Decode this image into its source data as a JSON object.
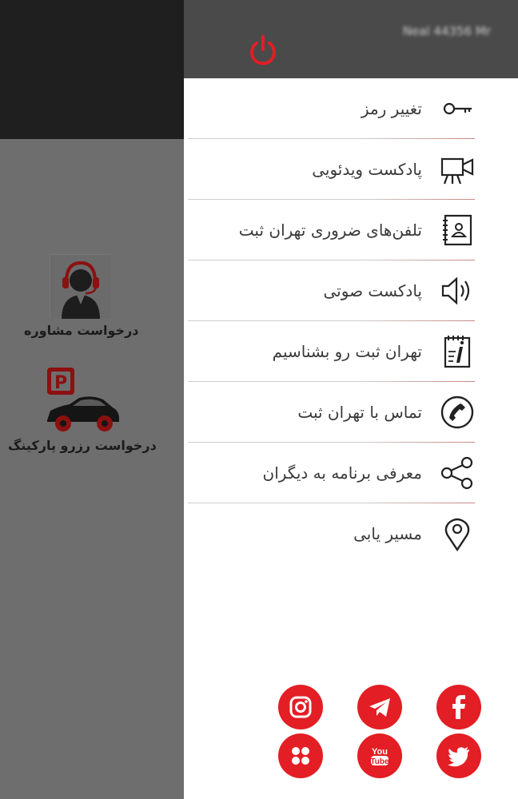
{
  "header": {
    "user_text": "Neal 44356 Mr",
    "power_icon": "power-icon"
  },
  "menu": [
    {
      "label": "تغییر رمز",
      "icon": "key-icon"
    },
    {
      "label": "پادکست ویدئویی",
      "icon": "video-camera-icon"
    },
    {
      "label": "تلفن‌های ضروری تهران ثبت",
      "icon": "address-book-icon"
    },
    {
      "label": "پادکست صوتی",
      "icon": "speaker-icon"
    },
    {
      "label": "تهران ثبت رو بشناسیم",
      "icon": "info-notepad-icon"
    },
    {
      "label": "تماس با تهران ثبت",
      "icon": "phone-icon"
    },
    {
      "label": "معرفی برنامه به دیگران",
      "icon": "share-icon"
    },
    {
      "label": "مسیر یابی",
      "icon": "location-pin-icon"
    }
  ],
  "background_tiles": {
    "consult_label": "درخواست مشاوره",
    "parking_label": "درخواست رزرو پارکینگ"
  },
  "social": [
    {
      "name": "instagram-icon"
    },
    {
      "name": "telegram-icon"
    },
    {
      "name": "facebook-icon"
    },
    {
      "name": "aparat-icon"
    },
    {
      "name": "youtube-icon",
      "text": "You Tube"
    },
    {
      "name": "twitter-icon"
    }
  ],
  "colors": {
    "accent": "#e31e24",
    "drawer_header": "#4a4a4a",
    "overlay": "#6e6e6e"
  }
}
